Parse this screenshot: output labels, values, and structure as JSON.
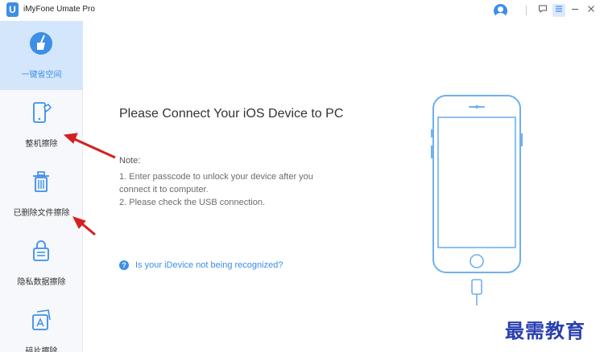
{
  "window": {
    "title": "iMyFone Umate Pro",
    "logo_letter": "U",
    "controls": {
      "feedback_icon": "feedback-icon",
      "menu_icon": "menu-icon",
      "minimize_icon": "minimize-icon",
      "close_icon": "close-icon"
    }
  },
  "sidebar": {
    "items": [
      {
        "label": "一键省空间",
        "icon": "broom-icon",
        "active": true
      },
      {
        "label": "整机擦除",
        "icon": "phone-eraser-icon",
        "active": false
      },
      {
        "label": "已删除文件擦除",
        "icon": "trash-can-icon",
        "active": false
      },
      {
        "label": "隐私数据擦除",
        "icon": "lock-icon",
        "active": false
      },
      {
        "label": "碎片擦除",
        "icon": "fragment-icon",
        "active": false
      }
    ]
  },
  "main": {
    "title": "Please Connect Your iOS Device to PC",
    "note_title": "Note:",
    "note_lines": [
      "1. Enter passcode to unlock your device after you",
      "connect it to computer.",
      "2. Please check the USB connection."
    ],
    "help_link": "Is your iDevice not being recognized?",
    "help_icon": "question-icon"
  },
  "watermark": "最需教育",
  "colors": {
    "accent": "#3c8ee8",
    "sidebar_bg": "#f6f8fb",
    "sidebar_active": "#d4e6fb",
    "annotation_arrow": "#d42020",
    "watermark": "#2a3fb0"
  }
}
